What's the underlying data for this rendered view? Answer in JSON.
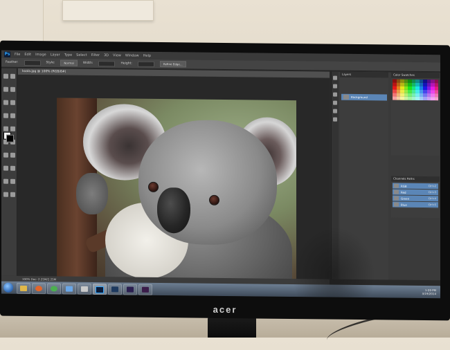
{
  "photoshop": {
    "logo": "Ps",
    "menu": [
      "File",
      "Edit",
      "Image",
      "Layer",
      "Type",
      "Select",
      "Filter",
      "3D",
      "View",
      "Window",
      "Help"
    ],
    "options": [
      "Feather:",
      "Style:",
      "Normal",
      "Width:",
      "Height:",
      "Refine Edge..."
    ],
    "doc_tab": "koala.jpg @ 100% (RGB/8#)",
    "status": "100%   Doc: 2.25M/2.25M",
    "layers_panel_title": "Layers",
    "layer_name": "Background",
    "swatches_tabs": "Color   Swatches",
    "channels_title": "Channels   Paths",
    "channels": [
      {
        "name": "RGB",
        "shortcut": "Ctrl+2"
      },
      {
        "name": "Red",
        "shortcut": "Ctrl+3"
      },
      {
        "name": "Green",
        "shortcut": "Ctrl+4"
      },
      {
        "name": "Blue",
        "shortcut": "Ctrl+5"
      }
    ]
  },
  "taskbar": {
    "time": "1:59 PM",
    "date": "3/19/2014"
  },
  "monitor": {
    "brand": "acer"
  }
}
